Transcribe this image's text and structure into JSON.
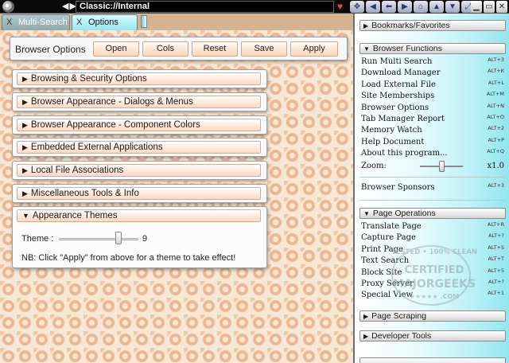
{
  "window": {
    "url": "Classic://Internal",
    "nav_arrows": "◀▶",
    "heart_glyph": "♥",
    "toolbar_icons": [
      {
        "name": "move-icon",
        "glyph": "✥"
      },
      {
        "name": "arrow-left-icon",
        "glyph": "◀"
      },
      {
        "name": "arrow-back-icon",
        "glyph": "⬅"
      },
      {
        "name": "arrow-right-icon",
        "glyph": "▶"
      },
      {
        "name": "home-icon",
        "glyph": "⌂"
      },
      {
        "name": "up-icon",
        "glyph": "▲"
      },
      {
        "name": "down-icon",
        "glyph": "▼"
      },
      {
        "name": "expand-icon",
        "glyph": "⤢"
      }
    ],
    "window_buttons": [
      {
        "name": "minimize-button",
        "glyph": "▁"
      },
      {
        "name": "restore-button",
        "glyph": "▭"
      },
      {
        "name": "close-button",
        "glyph": "✕"
      }
    ]
  },
  "tabs": {
    "multisearch_label": "Multi-Search",
    "options_label": "Options",
    "close_glyph": "X"
  },
  "options_bar": {
    "title": "Browser Options",
    "buttons": [
      "Open",
      "Cols",
      "Reset",
      "Save",
      "Apply"
    ]
  },
  "sections": [
    "Browsing & Security Options",
    "Browser Appearance - Dialogs & Menus",
    "Browser Appearance - Component Colors",
    "Embedded External Applications",
    "Local File Associations",
    "Miscellaneous Tools & Info"
  ],
  "themes": {
    "title": "Appearance Themes",
    "theme_label": "Theme :",
    "theme_value": "9",
    "theme_level": 0.75,
    "note": "NB: Click \"Apply\" from above for a theme to take effect!"
  },
  "sidebar": {
    "bookmarks": "Bookmarks/Favorites",
    "browser_functions": "Browser Functions",
    "function_items": [
      {
        "label": "Run Multi Search",
        "shortcut": "ALT+3"
      },
      {
        "label": "Download Manager",
        "shortcut": "ALT+K"
      },
      {
        "label": "Load External File",
        "shortcut": "ALT+L"
      },
      {
        "label": "Site Memberships",
        "shortcut": "ALT+M"
      },
      {
        "label": "Browser Options",
        "shortcut": "ALT+N"
      },
      {
        "label": "Tab Manager Report",
        "shortcut": "ALT+O"
      },
      {
        "label": "Memory Watch",
        "shortcut": "ALT+2"
      },
      {
        "label": "Help Document",
        "shortcut": "ALT+P"
      },
      {
        "label": "About this program...",
        "shortcut": "ALT+Q"
      }
    ],
    "zoom_label": "Zoom:",
    "zoom_value": "x1.0",
    "zoom_level": 0.45,
    "sponsors_label": "Browser Sponsors",
    "sponsors_shortcut": "ALT+3",
    "page_operations": "Page Operations",
    "page_items": [
      {
        "label": "Translate Page",
        "shortcut": "ALT+R"
      },
      {
        "label": "Capture Page",
        "shortcut": "ALT+?"
      },
      {
        "label": "Print Page",
        "shortcut": "ALT+S"
      },
      {
        "label": "Text Search",
        "shortcut": "ALT+T"
      },
      {
        "label": "Block Site",
        "shortcut": "ALT+5"
      },
      {
        "label": "Proxy Server",
        "shortcut": "ALT+?"
      },
      {
        "label": "Special View",
        "shortcut": "ALT+1"
      }
    ],
    "page_scraping": "Page Scraping",
    "developer_tools": "Developer Tools"
  },
  "watermark": {
    "line1": "TESTED • 100% CLEAN",
    "line2": "CERTIFIED",
    "line3": "MAJORGEEKS",
    "line4": "★★★★★ .COM"
  }
}
